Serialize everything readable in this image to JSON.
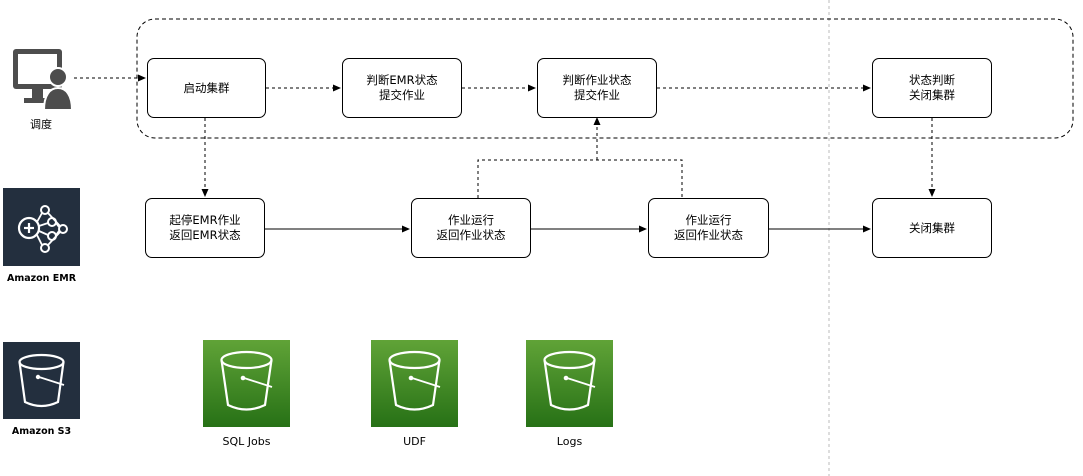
{
  "actors": {
    "scheduler": {
      "label": "调度",
      "icon": "user-computer-icon"
    }
  },
  "services": {
    "emr": {
      "label": "Amazon EMR",
      "icon": "emr-cluster-icon",
      "color": "#232F3E"
    },
    "s3": {
      "label": "Amazon S3",
      "icon": "s3-bucket-icon",
      "color": "#232F3E"
    }
  },
  "control_flow": {
    "start_cluster": [
      "启动集群"
    ],
    "check_emr_submit": [
      "判断EMR状态",
      "提交作业"
    ],
    "check_job_submit": [
      "判断作业状态",
      "提交作业"
    ],
    "check_state_close": [
      "状态判断",
      "关闭集群"
    ]
  },
  "execution_flow": {
    "start_stop_emr": [
      "起停EMR作业",
      "返回EMR状态"
    ],
    "job_run_1": [
      "作业运行",
      "返回作业状态"
    ],
    "job_run_2": [
      "作业运行",
      "返回作业状态"
    ],
    "close_cluster": [
      "关闭集群"
    ]
  },
  "buckets": [
    {
      "label": "SQL Jobs",
      "icon": "s3-bucket-icon"
    },
    {
      "label": "UDF",
      "icon": "s3-bucket-icon"
    },
    {
      "label": "Logs",
      "icon": "s3-bucket-icon"
    }
  ],
  "colors": {
    "bucket_green_top": "#60A337",
    "bucket_green_bottom": "#277116",
    "dark_service": "#232F3E",
    "scheduler_gray": "#4D4D4D",
    "line": "#000000",
    "divider": "#BBBBBB"
  }
}
